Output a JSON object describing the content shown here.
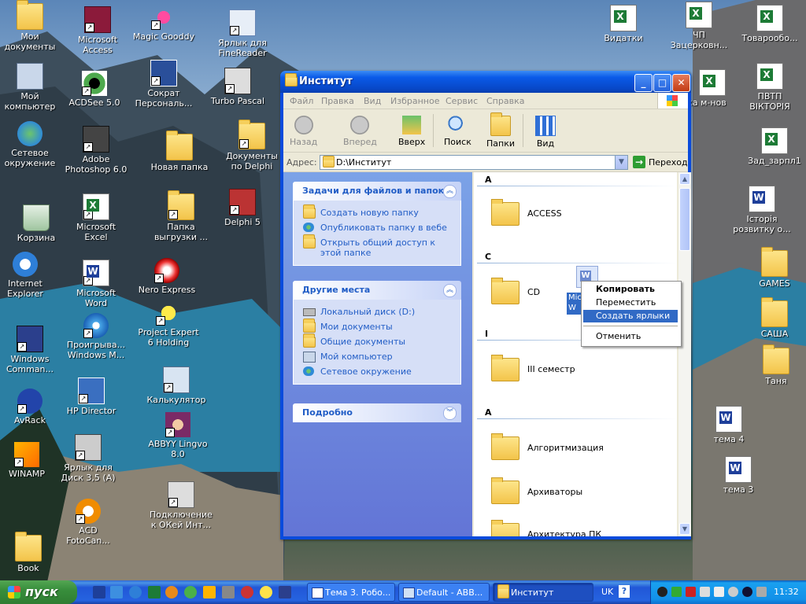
{
  "desktop": {
    "icons": [
      {
        "label": "Мои\nдокументы",
        "type": "folder"
      },
      {
        "label": "Microsoft\nAccess",
        "type": "app"
      },
      {
        "label": "Magic Gooddy",
        "type": "app"
      },
      {
        "label": "Ярлык для\nFineReader",
        "type": "app"
      },
      {
        "label": "Мой\nкомпьютер",
        "type": "app"
      },
      {
        "label": "ACDSee 5.0",
        "type": "app"
      },
      {
        "label": "Сократ\nПерсональ...",
        "type": "app"
      },
      {
        "label": "Turbo Pascal",
        "type": "app"
      },
      {
        "label": "Сетевое\nокружение",
        "type": "app"
      },
      {
        "label": "Adobe\nPhotoshop 6.0",
        "type": "app"
      },
      {
        "label": "Новая папка",
        "type": "folder"
      },
      {
        "label": "Документы\nпо Delphi",
        "type": "folder"
      },
      {
        "label": "Корзина",
        "type": "app"
      },
      {
        "label": "Microsoft\nExcel",
        "type": "xls"
      },
      {
        "label": "Папка\nвыгрузки ...",
        "type": "app"
      },
      {
        "label": "Delphi 5",
        "type": "app"
      },
      {
        "label": "Internet\nExplorer",
        "type": "app"
      },
      {
        "label": "Microsoft\nWord",
        "type": "doc"
      },
      {
        "label": "Nero Express",
        "type": "app"
      },
      {
        "label": "Project Expert\n6 Holding",
        "type": "app"
      },
      {
        "label": "Windows\nComman...",
        "type": "app"
      },
      {
        "label": "Проигрыва...\nWindows M...",
        "type": "app"
      },
      {
        "label": "HP Director",
        "type": "app"
      },
      {
        "label": "Калькулятор",
        "type": "app"
      },
      {
        "label": "AvRack",
        "type": "app"
      },
      {
        "label": "ABBYY Lingvo\n8.0",
        "type": "app"
      },
      {
        "label": "WINAMP",
        "type": "app"
      },
      {
        "label": "Ярлык для\nДиск 3,5 (A)",
        "type": "app"
      },
      {
        "label": "Подключение\nк ОКей Инт...",
        "type": "app"
      },
      {
        "label": "ACD\nFotoCan...",
        "type": "app"
      },
      {
        "label": "Book",
        "type": "folder"
      },
      {
        "label": "Видатки",
        "type": "xls"
      },
      {
        "label": "ЧП\nЗацерковн...",
        "type": "xls"
      },
      {
        "label": "Товарообо...",
        "type": "xls"
      },
      {
        "label": "ка м-нов",
        "type": "xls"
      },
      {
        "label": "ПВТП\nВІКТОРІЯ",
        "type": "xls"
      },
      {
        "label": "Зад_зарпл1",
        "type": "xls"
      },
      {
        "label": "Історія\nрозвитку о...",
        "type": "doc"
      },
      {
        "label": "GAMES",
        "type": "folder"
      },
      {
        "label": "САША",
        "type": "folder"
      },
      {
        "label": "Таня",
        "type": "folder"
      },
      {
        "label": "тема 4",
        "type": "doc"
      },
      {
        "label": "тема 3",
        "type": "doc"
      }
    ]
  },
  "window": {
    "title": "Институт",
    "menu": [
      "Файл",
      "Правка",
      "Вид",
      "Избранное",
      "Сервис",
      "Справка"
    ],
    "toolbar": {
      "back": "Назад",
      "forward": "Вперед",
      "up": "Вверх",
      "search": "Поиск",
      "folders": "Папки",
      "view": "Вид"
    },
    "address": {
      "label": "Адрес:",
      "value": "D:\\Институт",
      "go": "Переход"
    },
    "tasks_panel": {
      "title": "Задачи для файлов и папок",
      "items": [
        "Создать новую папку",
        "Опубликовать папку в вебе",
        "Открыть общий доступ к этой папке"
      ]
    },
    "other_places": {
      "title": "Другие места",
      "items": [
        "Локальный диск (D:)",
        "Мои документы",
        "Общие документы",
        "Мой компьютер",
        "Сетевое окружение"
      ]
    },
    "details": {
      "title": "Подробно"
    },
    "groups": [
      {
        "letter": "A",
        "items": [
          "ACCESS"
        ]
      },
      {
        "letter": "C",
        "items": [
          "CD"
        ]
      },
      {
        "letter": "I",
        "items": [
          "III семестр"
        ]
      },
      {
        "letter": "А",
        "items": [
          "Алгоритмизация",
          "Архиваторы",
          "Архитектура ПК"
        ]
      }
    ],
    "drag_item_label": "Mic\nW",
    "context_menu": {
      "items": [
        "Копировать",
        "Переместить",
        "Создать ярлыки",
        "Отменить"
      ],
      "selected": "Создать ярлыки"
    }
  },
  "taskbar": {
    "start": "пуск",
    "buttons": [
      "Тема 3. Робо...",
      "Default - ABB...",
      "Институт"
    ],
    "active": "Институт",
    "lang": "UK",
    "help": "?",
    "clock": "11:32"
  }
}
